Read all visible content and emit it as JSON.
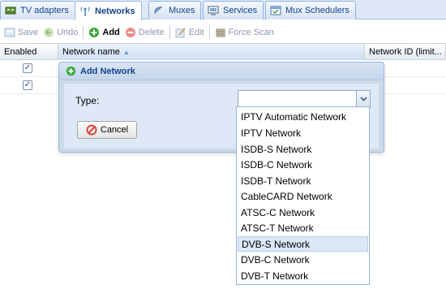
{
  "tabs": [
    {
      "label": "TV adapters",
      "icon": "tv-card-icon",
      "active": false
    },
    {
      "label": "Networks",
      "icon": "antenna-icon",
      "active": true
    },
    {
      "label": "Muxes",
      "icon": "satellite-dish-icon",
      "active": false
    },
    {
      "label": "Services",
      "icon": "monitor-icon",
      "active": false
    },
    {
      "label": "Mux Schedulers",
      "icon": "calendar-check-icon",
      "active": false
    }
  ],
  "toolbar": {
    "save": "Save",
    "undo": "Undo",
    "add": "Add",
    "delete": "Delete",
    "edit": "Edit",
    "force_scan": "Force Scan"
  },
  "grid": {
    "columns": [
      "Enabled",
      "Network name",
      "Network ID (limit..."
    ],
    "sorted_column": "Network name",
    "sort_direction": "ascending",
    "rows": [
      {
        "enabled": true
      },
      {
        "enabled": true
      }
    ]
  },
  "dialog": {
    "title": "Add Network",
    "type_label": "Type:",
    "type_value": "",
    "cancel_label": "Cancel"
  },
  "dropdown": {
    "options": [
      "IPTV Automatic Network",
      "IPTV Network",
      "ISDB-S Network",
      "ISDB-C Network",
      "ISDB-T Network",
      "CableCARD Network",
      "ATSC-C Network",
      "ATSC-T Network",
      "DVB-S Network",
      "DVB-C Network",
      "DVB-T Network"
    ],
    "hovered": "DVB-S Network"
  },
  "colors": {
    "accent": "#15428b",
    "add_green": "#3aa63a",
    "delete_red": "#d9443a",
    "hover_row": "#dce8f7"
  }
}
